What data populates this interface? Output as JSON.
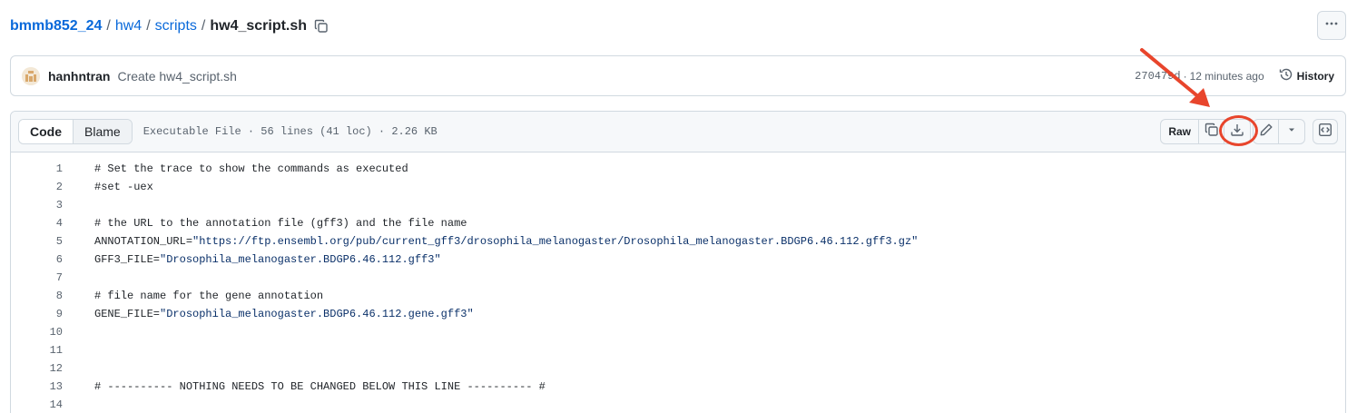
{
  "breadcrumb": {
    "repo": "bmmb852_24",
    "folder1": "hw4",
    "folder2": "scripts",
    "file": "hw4_script.sh",
    "separator": "/"
  },
  "commit": {
    "author": "hanhntran",
    "message": "Create hw4_script.sh",
    "sha": "270479d",
    "dot": "·",
    "time": "12 minutes ago",
    "history_label": "History"
  },
  "file_header": {
    "tab_code": "Code",
    "tab_blame": "Blame",
    "meta": "Executable File · 56 lines (41 loc) · 2.26 KB",
    "raw_label": "Raw"
  },
  "icons": {
    "copy": "copy-icon",
    "download": "download-icon",
    "edit": "pencil-icon",
    "dropdown": "triangle-down-icon",
    "symbols": "code-square-icon",
    "history": "history-icon",
    "kebab": "kebab-horizontal-icon"
  },
  "colors": {
    "link": "#0969da",
    "annotation": "#e8452c"
  },
  "code_lines": [
    {
      "n": "1",
      "text": "# Set the trace to show the commands as executed",
      "value": ""
    },
    {
      "n": "2",
      "text": "#set -uex",
      "value": ""
    },
    {
      "n": "3",
      "text": "",
      "value": ""
    },
    {
      "n": "4",
      "text": "# the URL to the annotation file (gff3) and the file name",
      "value": ""
    },
    {
      "n": "5",
      "text": "ANNOTATION_URL=",
      "value": "\"https://ftp.ensembl.org/pub/current_gff3/drosophila_melanogaster/Drosophila_melanogaster.BDGP6.46.112.gff3.gz\""
    },
    {
      "n": "6",
      "text": "GFF3_FILE=",
      "value": "\"Drosophila_melanogaster.BDGP6.46.112.gff3\""
    },
    {
      "n": "7",
      "text": "",
      "value": ""
    },
    {
      "n": "8",
      "text": "# file name for the gene annotation",
      "value": ""
    },
    {
      "n": "9",
      "text": "GENE_FILE=",
      "value": "\"Drosophila_melanogaster.BDGP6.46.112.gene.gff3\""
    },
    {
      "n": "10",
      "text": "",
      "value": ""
    },
    {
      "n": "11",
      "text": "",
      "value": ""
    },
    {
      "n": "12",
      "text": "",
      "value": ""
    },
    {
      "n": "13",
      "text": "# ---------- NOTHING NEEDS TO BE CHANGED BELOW THIS LINE ---------- #",
      "value": ""
    },
    {
      "n": "14",
      "text": "",
      "value": ""
    }
  ]
}
